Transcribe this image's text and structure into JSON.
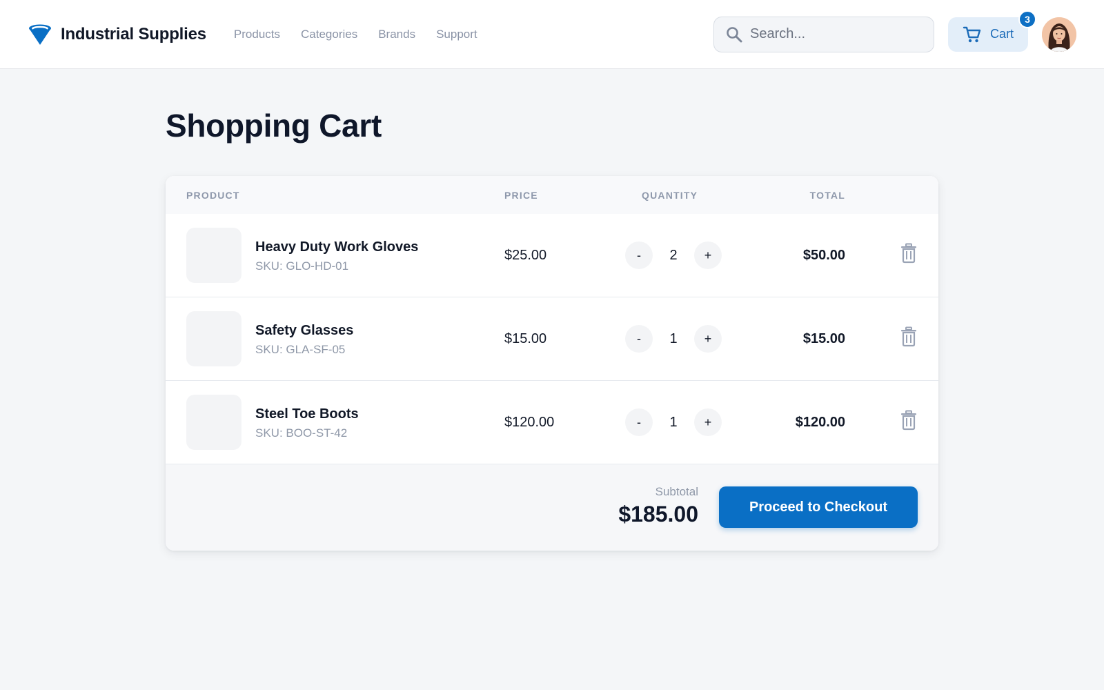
{
  "header": {
    "brand_name": "Industrial Supplies",
    "nav": [
      "Products",
      "Categories",
      "Brands",
      "Support"
    ],
    "search_placeholder": "Search...",
    "cart_label": "Cart",
    "cart_count": "3",
    "icons": {
      "logo": "funnel-logo-icon",
      "search": "search-icon",
      "cart": "shopping-cart-icon",
      "avatar": "user-avatar"
    }
  },
  "page": {
    "title": "Shopping Cart"
  },
  "table": {
    "columns": [
      "PRODUCT",
      "PRICE",
      "QUANTITY",
      "TOTAL"
    ],
    "items": [
      {
        "name": "Heavy Duty Work Gloves",
        "sku": "SKU: GLO-HD-01",
        "price": "$25.00",
        "qty": "2",
        "total": "$50.00"
      },
      {
        "name": "Safety Glasses",
        "sku": "SKU: GLA-SF-05",
        "price": "$15.00",
        "qty": "1",
        "total": "$15.00"
      },
      {
        "name": "Steel Toe Boots",
        "sku": "SKU: BOO-ST-42",
        "price": "$120.00",
        "qty": "1",
        "total": "$120.00"
      }
    ],
    "minus_label": "-",
    "plus_label": "+",
    "delete_icon": "trash-icon"
  },
  "summary": {
    "subtotal_label": "Subtotal",
    "subtotal_value": "$185.00",
    "checkout_label": "Proceed to Checkout"
  },
  "colors": {
    "accent": "#0a6fc5",
    "background": "#f4f6f8",
    "muted_text": "#8f98a8"
  }
}
